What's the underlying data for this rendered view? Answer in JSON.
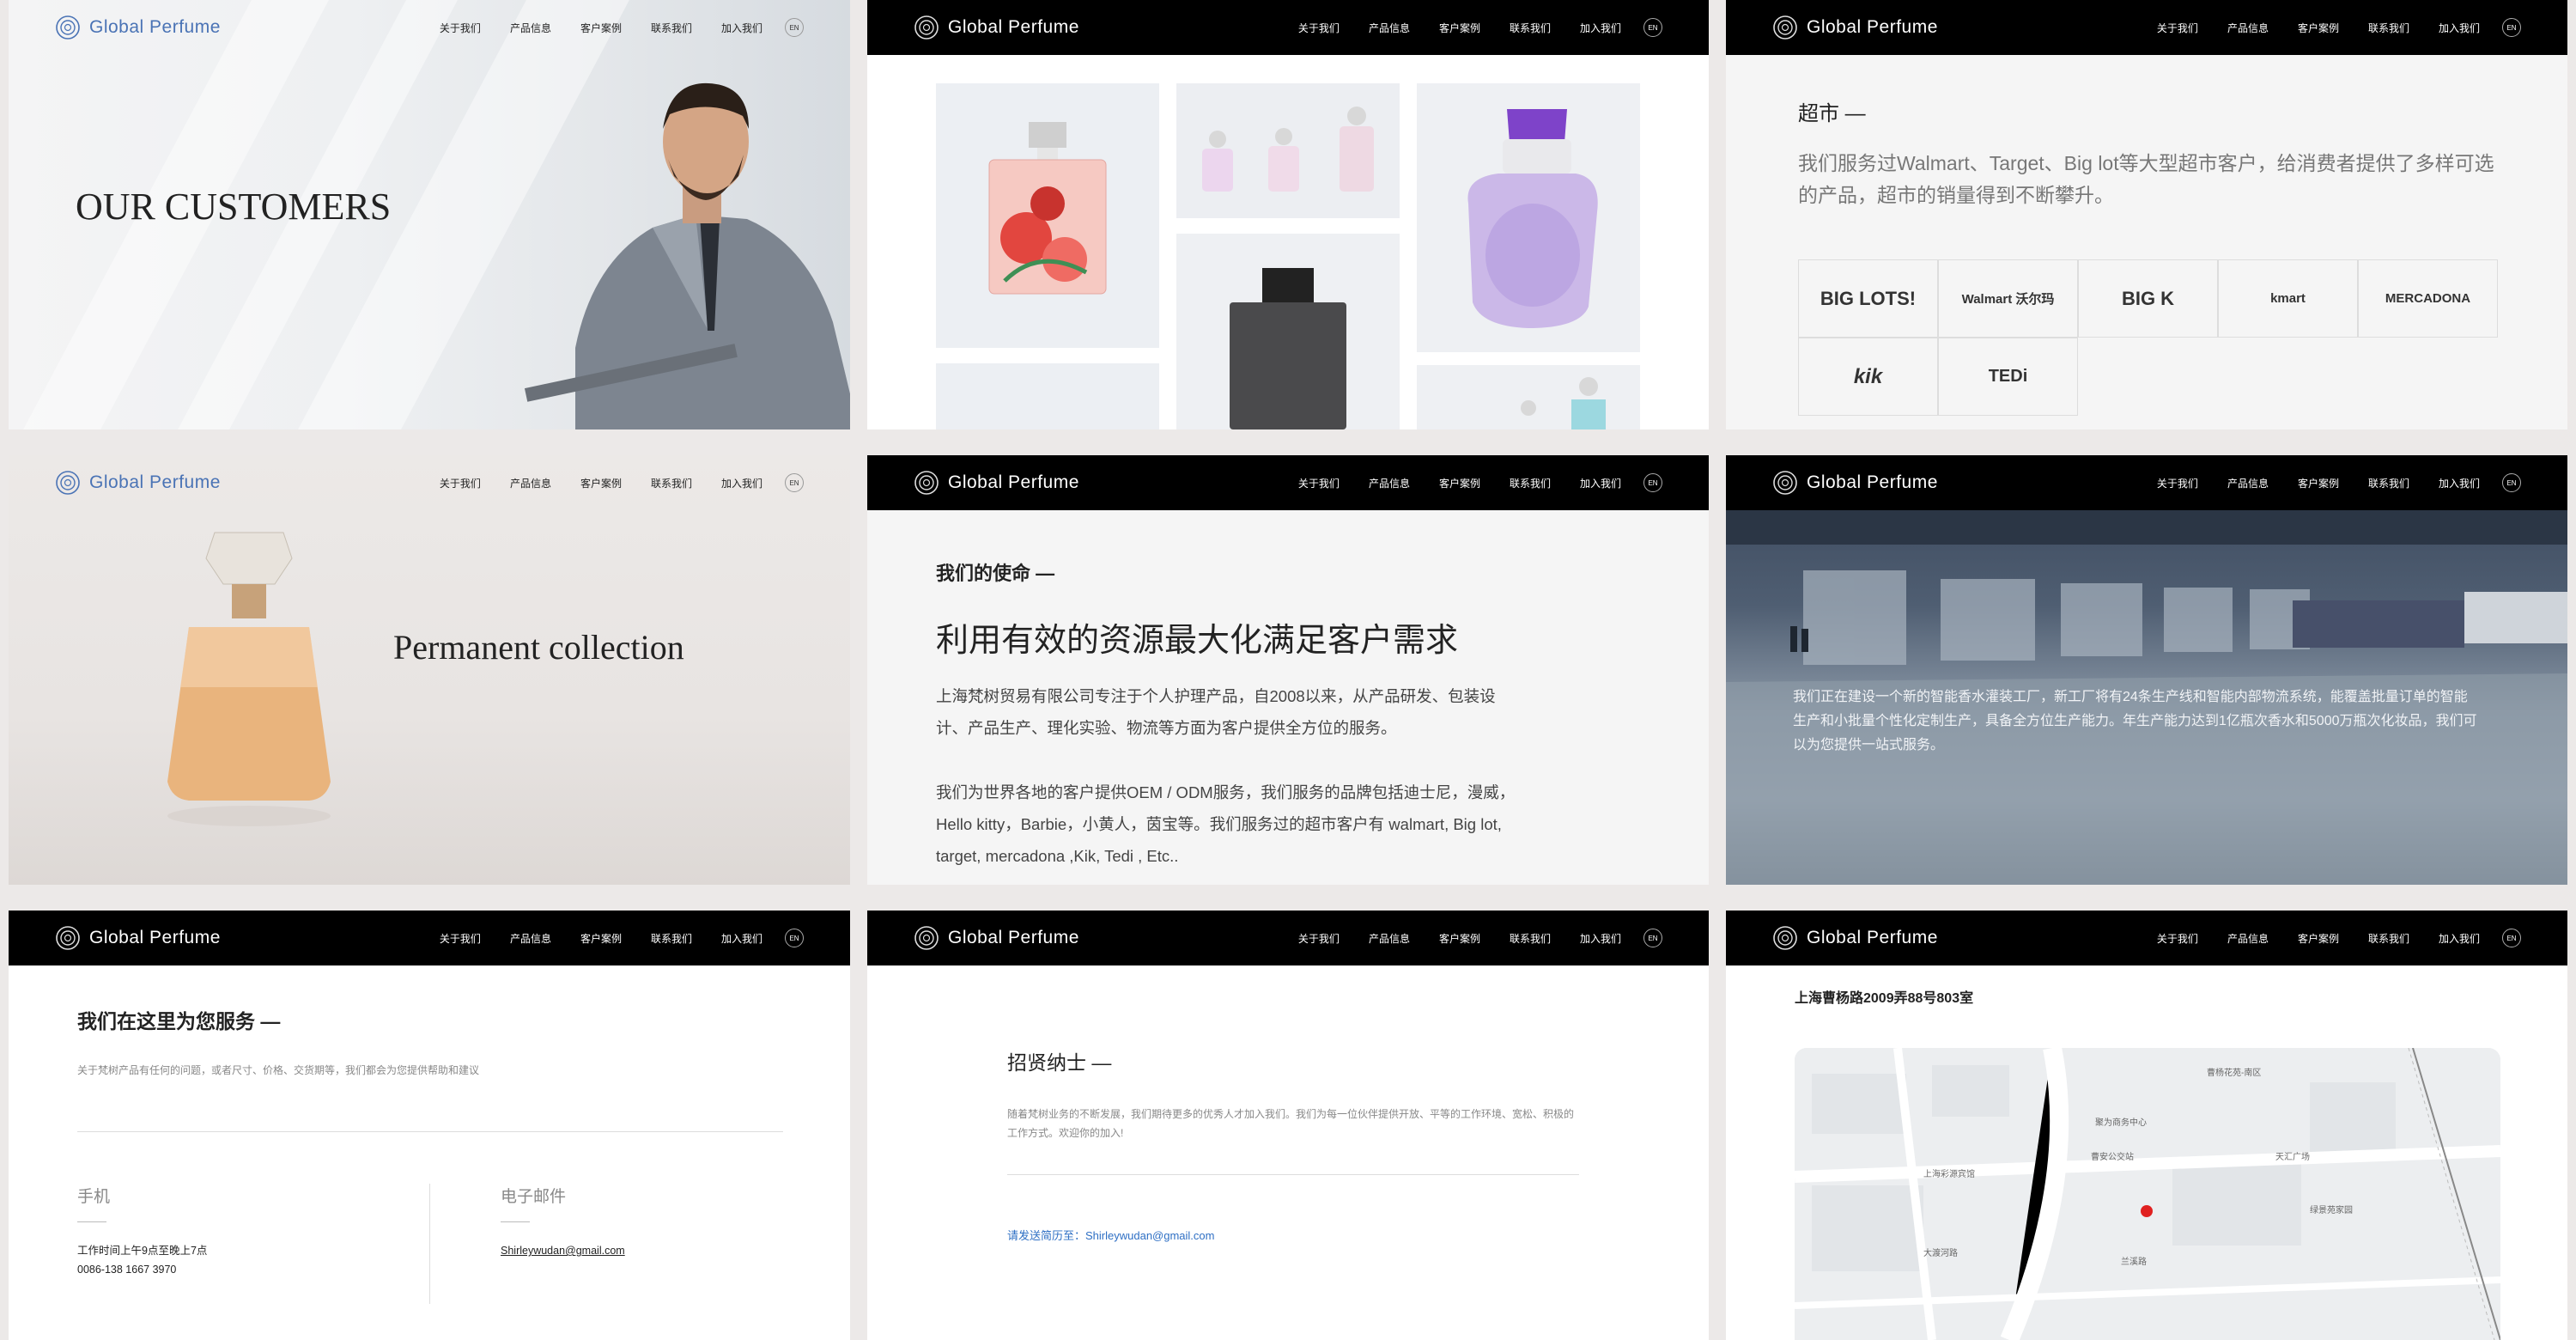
{
  "brand": {
    "name": "Global Perfume"
  },
  "nav": {
    "items": [
      "关于我们",
      "产品信息",
      "客户案例",
      "联系我们",
      "加入我们"
    ],
    "lang": "EN"
  },
  "colors": {
    "accent_blue": "#4a73b5",
    "nav_dark": "#000000",
    "link_blue": "#2e6fc4"
  },
  "panel1": {
    "title": "OUR CUSTOMERS"
  },
  "panel3": {
    "heading": "超市 —",
    "text": "我们服务过Walmart、Target、Big lot等大型超市客户，给消费者提供了多样可选的产品，超市的销量得到不断攀升。",
    "logos": [
      "BIG LOTS!",
      "Walmart 沃尔玛",
      "BIG K",
      "kmart",
      "MERCADONA",
      "kik",
      "TEDi"
    ]
  },
  "panel4": {
    "title": "Permanent collection"
  },
  "panel5": {
    "heading": "我们的使命 —",
    "big": "利用有效的资源最大化满足客户需求",
    "para1": "上海梵树贸易有限公司专注于个人护理产品，自2008以来，从产品研发、包装设计、产品生产、理化实验、物流等方面为客户提供全方位的服务。",
    "para2": "我们为世界各地的客户提供OEM / ODM服务，我们服务的品牌包括迪士尼，漫威，Hello kitty，Barbie，小黄人，茵宝等。我们服务过的超市客户有 walmart, Big lot, target, mercadona ,Kik, Tedi , Etc.."
  },
  "panel6": {
    "text": "我们正在建设一个新的智能香水灌装工厂，新工厂将有24条生产线和智能内部物流系统，能覆盖批量订单的智能生产和小批量个性化定制生产，具备全方位生产能力。年生产能力达到1亿瓶次香水和5000万瓶次化妆品，我们可以为您提供一站式服务。"
  },
  "panel7": {
    "heading": "我们在这里为您服务 —",
    "sub": "关于梵树产品有任何的问题，或者尺寸、价格、交货期等，我们都会为您提供帮助和建议",
    "phone_label": "手机",
    "phone_hours": "工作时间上午9点至晚上7点",
    "phone_number": "0086-138 1667 3970",
    "email_label": "电子邮件",
    "email": "Shirleywudan@gmail.com"
  },
  "panel8": {
    "heading": "招贤纳士 —",
    "text": "随着梵树业务的不断发展，我们期待更多的优秀人才加入我们。我们为每一位伙伴提供开放、平等的工作环境、宽松、积极的工作方式。欢迎你的加入!",
    "resume": "请发送简历至：Shirleywudan@gmail.com"
  },
  "panel9": {
    "address": "上海曹杨路2009弄88号803室",
    "map_labels": [
      "曹杨花苑-南区",
      "聚为商务中心",
      "天汇广场",
      "绿景苑家园",
      "上海彩源宾馆",
      "曹安公交站",
      "大渡河路",
      "兰溪路"
    ]
  }
}
